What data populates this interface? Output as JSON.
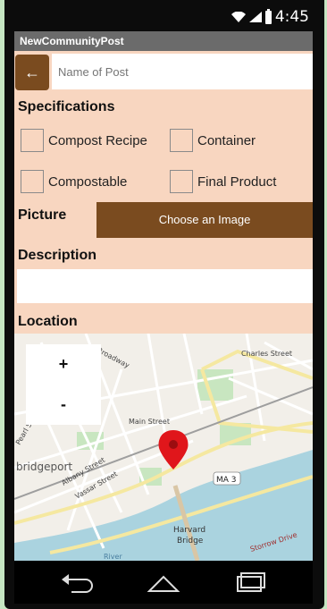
{
  "status": {
    "time": "4:45"
  },
  "app_bar": {
    "title": "NewCommunityPost"
  },
  "form": {
    "back_label": "←",
    "name_placeholder": "Name of Post",
    "specifications_label": "Specifications",
    "checkboxes": [
      {
        "label": "Compost Recipe"
      },
      {
        "label": "Container"
      },
      {
        "label": "Compostable"
      },
      {
        "label": "Final Product"
      }
    ],
    "picture_label": "Picture",
    "choose_image_label": "Choose an Image",
    "description_label": "Description",
    "location_label": "Location"
  },
  "map": {
    "zoom_in": "+",
    "zoom_out": "-",
    "labels": {
      "broadway": "Broadway",
      "charles_street": "Charles Street",
      "main_street": "Main Street",
      "bridgeport": "bridgeport",
      "albany_street": "Albany Street",
      "vassar_street": "Vassar Street",
      "pearl_street": "Pearl Street",
      "ma3": "MA 3",
      "harvard_bridge": "Harvard\nBridge",
      "storrow_drive": "Storrow Drive",
      "river": "River"
    },
    "colors": {
      "land": "#f2efe9",
      "water": "#aad3df",
      "park": "#c8e6c0",
      "road": "#ffffff",
      "major_road": "#f5e8a0",
      "pin": "#e0161b"
    }
  },
  "colors": {
    "accent": "#7a4b1f",
    "background": "#f8d6c0",
    "app_bar": "#6b6b6b"
  }
}
